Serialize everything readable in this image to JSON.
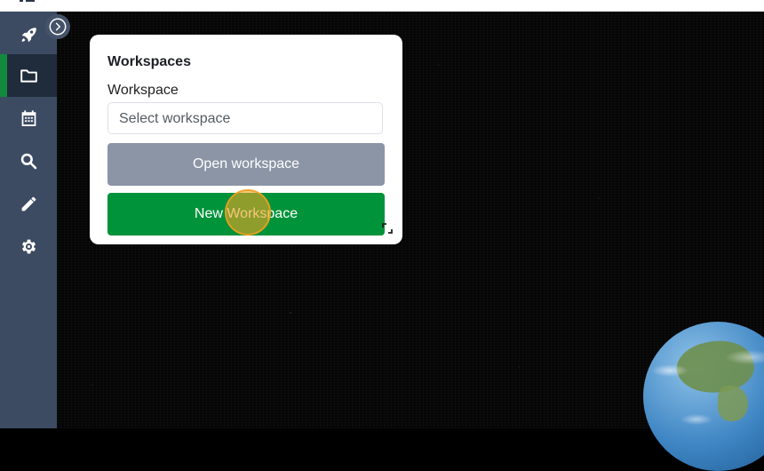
{
  "sidebar": {
    "collapse_toggle_icon": "chevron-right-circle-icon",
    "items": [
      {
        "name": "launch",
        "icon": "rocket-icon",
        "active": false
      },
      {
        "name": "workspaces",
        "icon": "folder-icon",
        "active": true
      },
      {
        "name": "calendar",
        "icon": "calendar-icon",
        "active": false
      },
      {
        "name": "search",
        "icon": "search-icon",
        "active": false
      },
      {
        "name": "edit",
        "icon": "pencil-icon",
        "active": false
      },
      {
        "name": "settings",
        "icon": "gear-icon",
        "active": false
      }
    ],
    "colors": {
      "background": "#3c4b62",
      "active_background": "#202b3b",
      "active_indicator": "#128a3e"
    }
  },
  "panel": {
    "title": "Workspaces",
    "field_label": "Workspace",
    "select_placeholder": "Select workspace",
    "open_button": "Open workspace",
    "new_button": "New Workspace",
    "colors": {
      "open_button": "#8b95a5",
      "new_button": "#00933a"
    }
  },
  "background": {
    "type": "starfield-with-earth-globe"
  }
}
